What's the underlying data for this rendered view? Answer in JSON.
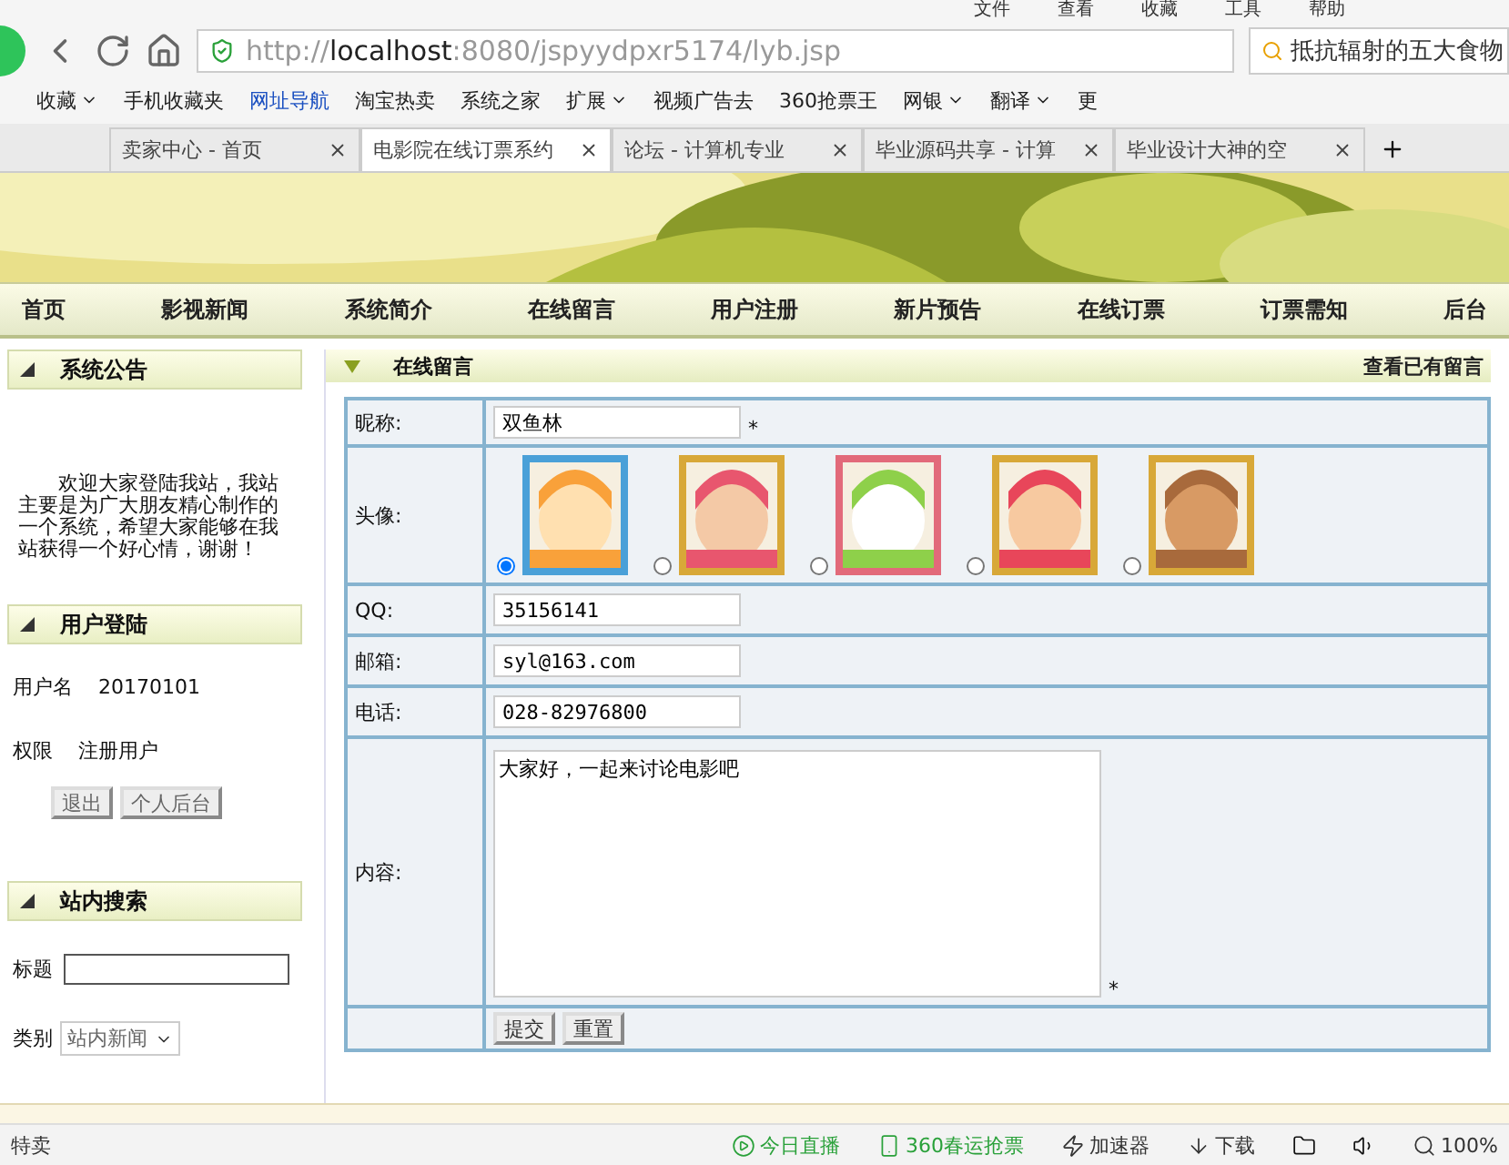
{
  "browser": {
    "menu": [
      "文件",
      "查看",
      "收藏",
      "工具",
      "帮助"
    ],
    "address": {
      "scheme": "http://",
      "host": "localhost",
      "path": ":8080/jspyydpxr5174/lyb.jsp"
    },
    "search": {
      "value": "抵抗辐射的五大食物"
    },
    "bookmarks": [
      {
        "label": "收藏",
        "dropdown": true
      },
      {
        "label": "手机收藏夹",
        "dropdown": false
      },
      {
        "label": "网址导航",
        "dropdown": false
      },
      {
        "label": "淘宝热卖",
        "dropdown": false
      },
      {
        "label": "系统之家",
        "dropdown": false
      }
    ],
    "extras": [
      {
        "label": "扩展",
        "dropdown": true
      },
      {
        "label": "视频广告去",
        "dropdown": false
      },
      {
        "label": "360抢票王",
        "dropdown": false
      },
      {
        "label": "网银",
        "dropdown": true
      },
      {
        "label": "翻译",
        "dropdown": true
      },
      {
        "label": "更",
        "dropdown": false
      }
    ],
    "tabs": [
      {
        "label": "卖家中心 - 首页",
        "selected": false
      },
      {
        "label": "电影院在线订票系约",
        "selected": true
      },
      {
        "label": "论坛 - 计算机专业",
        "selected": false
      },
      {
        "label": "毕业源码共享 - 计算",
        "selected": false
      },
      {
        "label": "毕业设计大神的空",
        "selected": false
      }
    ]
  },
  "nav": [
    "首页",
    "影视新闻",
    "系统简介",
    "在线留言",
    "用户注册",
    "新片预告",
    "在线订票",
    "订票需知",
    "后台"
  ],
  "sidebar": {
    "notice": {
      "title": "系统公告",
      "text": "欢迎大家登陆我站，我站主要是为广大朋友精心制作的一个系统，希望大家能够在我站获得一个好心情，谢谢！"
    },
    "login": {
      "title": "用户登陆",
      "fields": [
        {
          "label": "用户名",
          "value": "20170101"
        },
        {
          "label": "权限",
          "value": "注册用户"
        }
      ],
      "buttons": [
        "退出",
        "个人后台"
      ]
    },
    "search": {
      "title": "站内搜索",
      "title_label": "标题",
      "category_label": "类别",
      "category": "站内新闻"
    }
  },
  "form": {
    "title": "在线留言",
    "link": "查看已有留言",
    "nickname": {
      "label": "昵称:",
      "value": "双鱼林",
      "required": "*"
    },
    "avatar": {
      "label": "头像:",
      "options": [
        {
          "selected": true
        },
        {
          "selected": false
        },
        {
          "selected": false
        },
        {
          "selected": false
        },
        {
          "selected": false
        }
      ]
    },
    "fields": [
      {
        "label": "QQ:",
        "value": "35156141"
      },
      {
        "label": "邮箱:",
        "value": "syl@163.com"
      },
      {
        "label": "电话:",
        "value": "028-82976800"
      }
    ],
    "content": {
      "label": "内容:",
      "value": "大家好，一起来讨论电影吧",
      "required": "*"
    },
    "buttons": [
      "提交",
      "重置"
    ]
  },
  "status_bar": {
    "left": "特卖",
    "items": [
      "今日直播",
      "360春运抢票",
      "加速器",
      "下载"
    ],
    "zoom": "100%"
  }
}
